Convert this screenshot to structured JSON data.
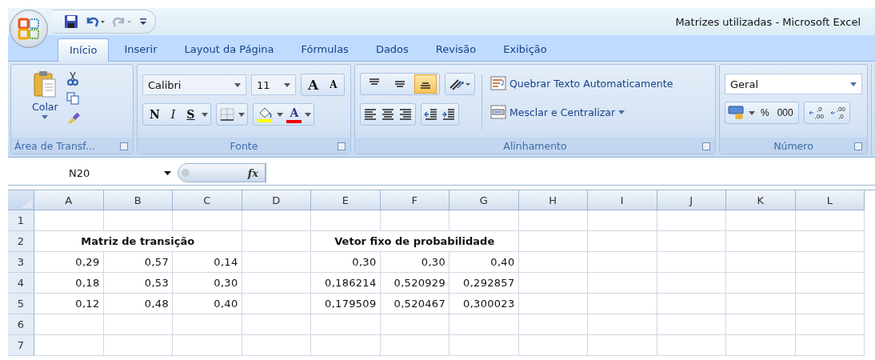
{
  "window": {
    "title": "Matrizes utilizadas - Microsoft Excel"
  },
  "tabs": [
    {
      "label": "Início",
      "selected": true
    },
    {
      "label": "Inserir",
      "selected": false
    },
    {
      "label": "Layout da Página",
      "selected": false
    },
    {
      "label": "Fórmulas",
      "selected": false
    },
    {
      "label": "Dados",
      "selected": false
    },
    {
      "label": "Revisão",
      "selected": false
    },
    {
      "label": "Exibição",
      "selected": false
    }
  ],
  "ribbon": {
    "clipboard": {
      "paste_label": "Colar",
      "title": "Área de Transf..."
    },
    "font": {
      "font_name": "Calibri",
      "font_size": "11",
      "grow_glyph": "A",
      "shrink_glyph": "A",
      "bold_glyph": "N",
      "italic_glyph": "I",
      "underline_glyph": "S",
      "color_glyph": "A",
      "title": "Fonte"
    },
    "alignment": {
      "vertical_align": [
        {
          "selected": false
        },
        {
          "selected": false
        },
        {
          "selected": true
        }
      ],
      "wrap_text": "Quebrar Texto Automaticamente",
      "merge_center": "Mesclar e Centralizar",
      "title": "Alinhamento"
    },
    "number": {
      "format": "Geral",
      "percent": "%",
      "thousands": "000",
      "decimal_buttons": [
        {
          "top": ",0",
          "bottom": ",00"
        },
        {
          "top": ",00",
          "bottom": ",0"
        }
      ],
      "title": "Número"
    }
  },
  "formula_bar": {
    "name_box": "N20",
    "function_glyph": "fx"
  },
  "sheet": {
    "columns": [
      "A",
      "B",
      "C",
      "D",
      "E",
      "F",
      "G",
      "H",
      "I",
      "J",
      "K",
      "L"
    ],
    "rows": [
      {
        "number": "1",
        "cells": []
      },
      {
        "number": "2",
        "cells": [
          {
            "text": "Matriz de transição",
            "colspan": 3,
            "bold": true
          },
          {
            "text": ""
          },
          {
            "text": "Vetor fixo de probabilidade",
            "colspan": 3,
            "bold": true
          }
        ]
      },
      {
        "number": "3",
        "cells": [
          {
            "text": "0,29"
          },
          {
            "text": "0,57"
          },
          {
            "text": "0,14"
          },
          {
            "text": ""
          },
          {
            "text": "0,30"
          },
          {
            "text": "0,30"
          },
          {
            "text": "0,40"
          }
        ]
      },
      {
        "number": "4",
        "cells": [
          {
            "text": "0,18"
          },
          {
            "text": "0,53"
          },
          {
            "text": "0,30"
          },
          {
            "text": ""
          },
          {
            "text": "0,186214"
          },
          {
            "text": "0,520929"
          },
          {
            "text": "0,292857"
          }
        ]
      },
      {
        "number": "5",
        "cells": [
          {
            "text": "0,12"
          },
          {
            "text": "0,48"
          },
          {
            "text": "0,40"
          },
          {
            "text": ""
          },
          {
            "text": "0,179509"
          },
          {
            "text": "0,520467"
          },
          {
            "text": "0,300023"
          }
        ]
      },
      {
        "number": "6",
        "cells": []
      },
      {
        "number": "7",
        "cells": []
      }
    ]
  }
}
